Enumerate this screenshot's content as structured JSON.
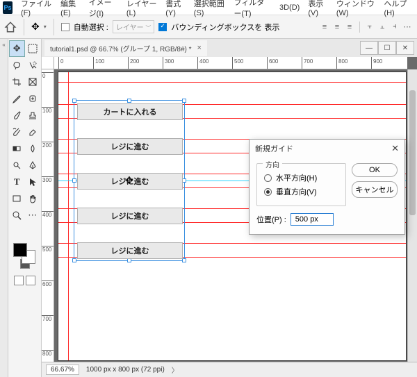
{
  "app": {
    "logo": "Ps"
  },
  "menu": {
    "items": [
      "ファイル(F)",
      "編集(E)",
      "イメージ(I)",
      "レイヤー(L)",
      "書式(Y)",
      "選択範囲(S)",
      "フィルター(T)",
      "3D(D)",
      "表示(V)",
      "ウィンドウ(W)",
      "ヘルプ(H)"
    ]
  },
  "options": {
    "autoselect_label": "自動選択 :",
    "layer_dropdown": "レイヤー",
    "bbox_label": "バウンディングボックスを 表示"
  },
  "document": {
    "tab_title": "tutorial1.psd @ 66.7% (グループ 1, RGB/8#) *",
    "zoom": "66.67%",
    "dims": "1000 px x 800 px (72 ppi)"
  },
  "ruler_h": [
    0,
    100,
    200,
    300,
    400,
    500,
    600,
    700,
    800,
    900
  ],
  "ruler_v": [
    0,
    100,
    200,
    300,
    400,
    500,
    600,
    700,
    800
  ],
  "buttons": {
    "items": [
      "カートに入れる",
      "レジに進む",
      "レジに進む",
      "レジに進む",
      "レジに進む"
    ]
  },
  "dialog": {
    "title": "新規ガイド",
    "direction_legend": "方向",
    "radio_h": "水平方向(H)",
    "radio_v": "垂直方向(V)",
    "selected": "v",
    "position_label": "位置(P) :",
    "position_value": "500 px",
    "ok": "OK",
    "cancel": "キャンセル"
  }
}
